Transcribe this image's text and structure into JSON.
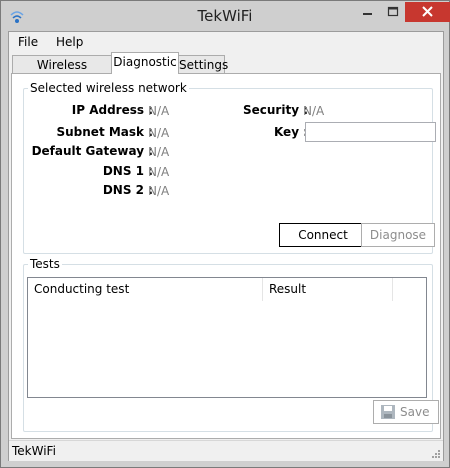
{
  "window": {
    "title": "TekWiFi"
  },
  "menu": {
    "file": "File",
    "help": "Help"
  },
  "tabs": [
    "Wireless Networks",
    "Diagnostic",
    "Settings"
  ],
  "network_group": {
    "title": "Selected wireless network",
    "ip_label": "IP Address :",
    "ip_value": "N/A",
    "subnet_label": "Subnet Mask :",
    "subnet_value": "N/A",
    "gateway_label": "Default Gateway :",
    "gateway_value": "N/A",
    "dns1_label": "DNS 1 :",
    "dns1_value": "N/A",
    "dns2_label": "DNS 2 :",
    "dns2_value": "N/A",
    "security_label": "Security :",
    "security_value": "N/A",
    "key_label": "Key :",
    "key_value": "",
    "connect_label": "Connect",
    "diagnose_label": "Diagnose"
  },
  "tests_group": {
    "title": "Tests",
    "columns": [
      "Conducting test",
      "Result"
    ],
    "save_label": "Save"
  },
  "status": {
    "text": "TekWiFi"
  },
  "icons": {
    "app": "wifi-icon",
    "save": "floppy-disk-icon"
  }
}
